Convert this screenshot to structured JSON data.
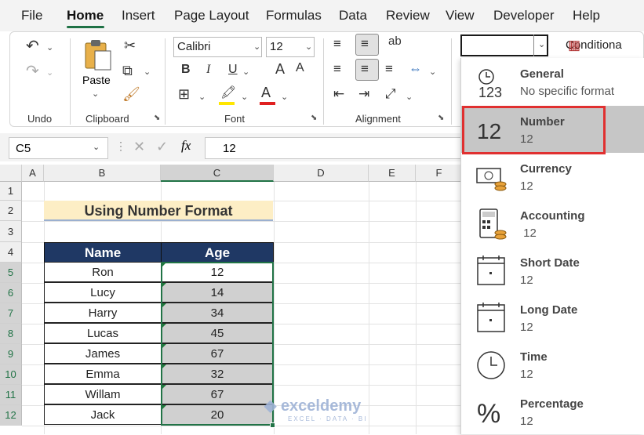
{
  "menu": {
    "tabs": [
      "File",
      "Home",
      "Insert",
      "Page Layout",
      "Formulas",
      "Data",
      "Review",
      "View",
      "Developer",
      "Help"
    ],
    "active": "Home"
  },
  "ribbon": {
    "undo_label": "Undo",
    "clipboard_label": "Clipboard",
    "paste_label": "Paste",
    "font_label": "Font",
    "alignment_label": "Alignment",
    "font_name": "Calibri",
    "font_size": "12",
    "number_format_value": "",
    "conditional_label": "Conditiona"
  },
  "formula_bar": {
    "cell_ref": "C5",
    "fx": "fx",
    "value": "12"
  },
  "columns": [
    "A",
    "B",
    "C",
    "D",
    "E",
    "F"
  ],
  "rows": [
    "1",
    "2",
    "3",
    "4",
    "5",
    "6",
    "7",
    "8",
    "9",
    "10",
    "11",
    "12"
  ],
  "sheet": {
    "title": "Using Number Format",
    "headers": [
      "Name",
      "Age"
    ],
    "data": [
      {
        "name": "Ron",
        "age": "12"
      },
      {
        "name": "Lucy",
        "age": "14"
      },
      {
        "name": "Harry",
        "age": "34"
      },
      {
        "name": "Lucas",
        "age": "45"
      },
      {
        "name": "James",
        "age": "67"
      },
      {
        "name": "Emma",
        "age": "32"
      },
      {
        "name": "Willam",
        "age": "67"
      },
      {
        "name": "Jack",
        "age": "20"
      }
    ]
  },
  "format_panel": {
    "items": [
      {
        "name": "General",
        "sample": "No specific format",
        "icon": "general-icon"
      },
      {
        "name": "Number",
        "sample": "12",
        "icon": "number-icon"
      },
      {
        "name": "Currency",
        "sample": "12",
        "icon": "currency-icon"
      },
      {
        "name": "Accounting",
        "sample": " 12",
        "icon": "accounting-icon"
      },
      {
        "name": "Short Date",
        "sample": "12",
        "icon": "calendar-icon"
      },
      {
        "name": "Long Date",
        "sample": "12",
        "icon": "calendar-icon"
      },
      {
        "name": "Time",
        "sample": "12",
        "icon": "clock-icon"
      },
      {
        "name": "Percentage",
        "sample": "12",
        "icon": "percent-icon"
      }
    ],
    "highlighted": "Number"
  },
  "watermark": {
    "brand": "exceldemy",
    "tagline": "EXCEL · DATA · BI"
  },
  "colors": {
    "accent": "#217346",
    "header_bg": "#1f3864",
    "title_bg": "#fdeec5",
    "highlight_border": "#e03030"
  }
}
